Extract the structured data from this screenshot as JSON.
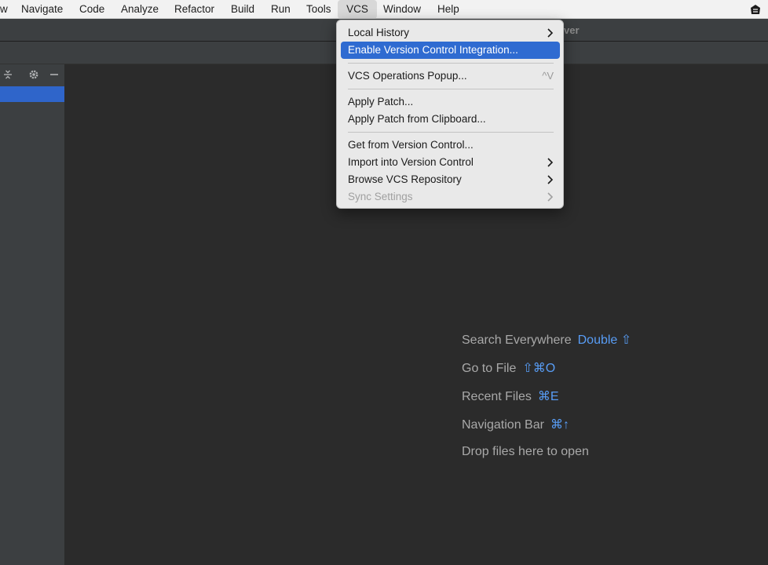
{
  "menubar": {
    "items": [
      "w",
      "Navigate",
      "Code",
      "Analyze",
      "Refactor",
      "Build",
      "Run",
      "Tools",
      "VCS",
      "Window",
      "Help"
    ],
    "active": "VCS",
    "tray_icon": "app-tray-icon"
  },
  "window": {
    "title_fragment": "ver"
  },
  "vcs_menu": {
    "items": [
      {
        "label": "Local History",
        "submenu": true
      },
      {
        "label": "Enable Version Control Integration...",
        "highlighted": true
      },
      {
        "label": "VCS Operations Popup...",
        "shortcut": "^V"
      },
      {
        "label": "Apply Patch..."
      },
      {
        "label": "Apply Patch from Clipboard..."
      },
      {
        "label": "Get from Version Control..."
      },
      {
        "label": "Import into Version Control",
        "submenu": true
      },
      {
        "label": "Browse VCS Repository",
        "submenu": true
      },
      {
        "label": "Sync Settings",
        "submenu": true,
        "disabled": true
      }
    ]
  },
  "editor_hints": [
    {
      "text": "Search Everywhere",
      "key": "Double ⇧"
    },
    {
      "text": "Go to File",
      "key": "⇧⌘O"
    },
    {
      "text": "Recent Files",
      "key": "⌘E"
    },
    {
      "text": "Navigation Bar",
      "key": "⌘↑"
    },
    {
      "text": "Drop files here to open",
      "key": ""
    }
  ],
  "colors": {
    "accent": "#2f6bd1",
    "shortcut_blue": "#589df6",
    "editor_bg": "#2b2b2b"
  }
}
